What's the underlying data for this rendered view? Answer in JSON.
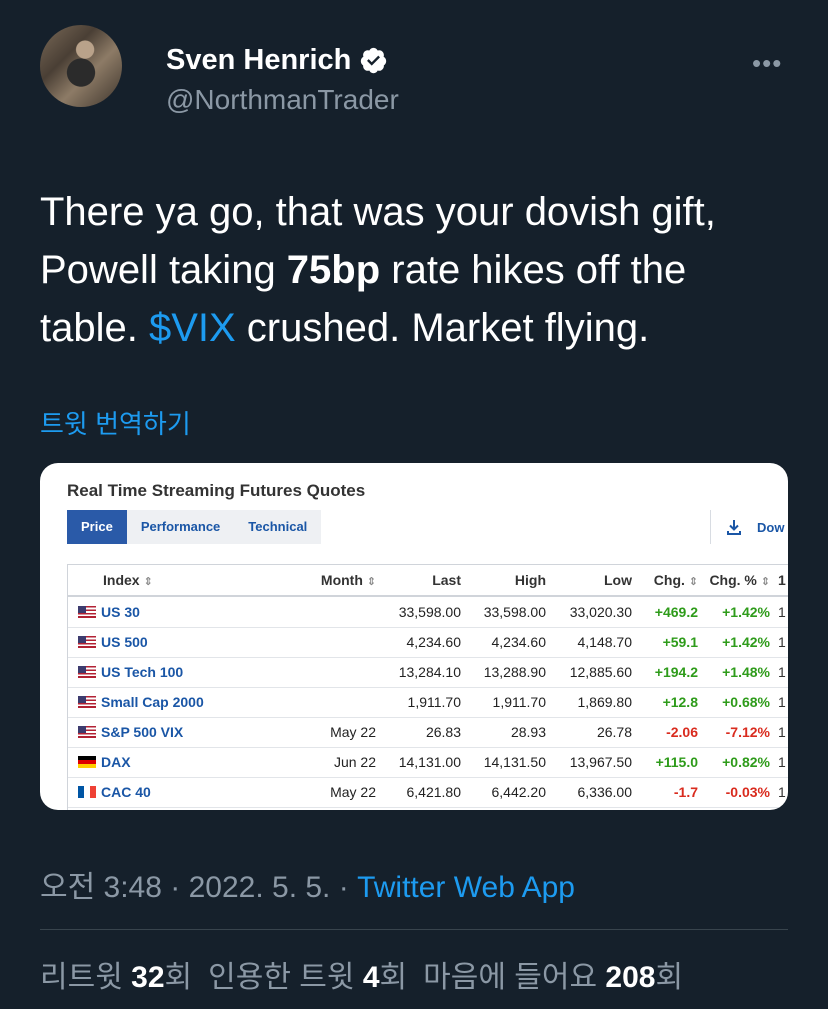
{
  "author": {
    "name": "Sven Henrich",
    "handle": "@NorthmanTrader"
  },
  "tweet": {
    "line1": "There ya go, that was your dovish gift,",
    "line2_pre": "Powell taking ",
    "line2_bold": "75bp",
    "line2_post": " rate hikes off the",
    "line3_pre": "table. ",
    "cashtag": "$VIX",
    "line3_post": " crushed. Market flying."
  },
  "translate_label": "트윗 번역하기",
  "card": {
    "title": "Real Time Streaming Futures Quotes",
    "tabs": [
      "Price",
      "Performance",
      "Technical"
    ],
    "download_label": "Dow",
    "headers": {
      "index": "Index",
      "month": "Month",
      "last": "Last",
      "high": "High",
      "low": "Low",
      "chg": "Chg.",
      "chgp": "Chg. %",
      "extra": "1"
    },
    "rows": [
      {
        "flag": "us",
        "symbol": "US 30",
        "month": "",
        "last": "33,598.00",
        "high": "33,598.00",
        "low": "33,020.30",
        "chg": "+469.2",
        "chgp": "+1.42%",
        "extra": "1"
      },
      {
        "flag": "us",
        "symbol": "US 500",
        "month": "",
        "last": "4,234.60",
        "high": "4,234.60",
        "low": "4,148.70",
        "chg": "+59.1",
        "chgp": "+1.42%",
        "extra": "1"
      },
      {
        "flag": "us",
        "symbol": "US Tech 100",
        "month": "",
        "last": "13,284.10",
        "high": "13,288.90",
        "low": "12,885.60",
        "chg": "+194.2",
        "chgp": "+1.48%",
        "extra": "1"
      },
      {
        "flag": "us",
        "symbol": "Small Cap 2000",
        "month": "",
        "last": "1,911.70",
        "high": "1,911.70",
        "low": "1,869.80",
        "chg": "+12.8",
        "chgp": "+0.68%",
        "extra": "1"
      },
      {
        "flag": "us",
        "symbol": "S&P 500 VIX",
        "month": "May 22",
        "last": "26.83",
        "high": "28.93",
        "low": "26.78",
        "chg": "-2.06",
        "chgp": "-7.12%",
        "extra": "1"
      },
      {
        "flag": "de",
        "symbol": "DAX",
        "month": "Jun 22",
        "last": "14,131.00",
        "high": "14,131.50",
        "low": "13,967.50",
        "chg": "+115.0",
        "chgp": "+0.82%",
        "extra": "1"
      },
      {
        "flag": "fr",
        "symbol": "CAC 40",
        "month": "May 22",
        "last": "6,421.80",
        "high": "6,442.20",
        "low": "6,336.00",
        "chg": "-1.7",
        "chgp": "-0.03%",
        "extra": "1"
      }
    ]
  },
  "meta": {
    "time": "오전 3:48",
    "sep": " · ",
    "date": "2022. 5. 5.",
    "source": "Twitter Web App"
  },
  "stats": {
    "retweets_label": "리트윗",
    "retweets": "32",
    "quotes_label": "인용한 트윗",
    "quotes": "4",
    "likes_label": "마음에 들어요",
    "likes": "208",
    "unit": "회"
  },
  "colors": {
    "background": "#15202b",
    "link": "#1d9bf0",
    "muted": "#8b98a5",
    "positive": "#2e9b1a",
    "negative": "#d92b1e"
  }
}
